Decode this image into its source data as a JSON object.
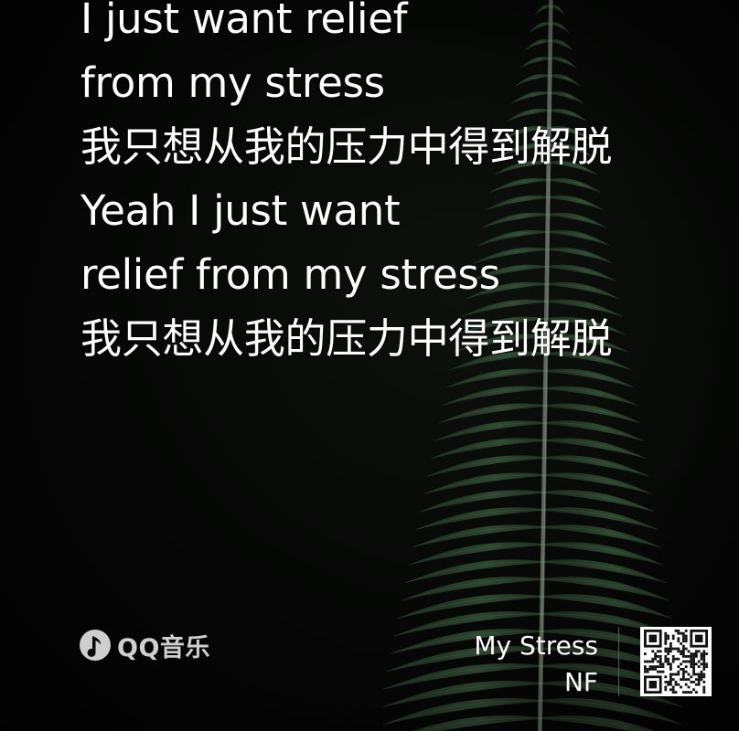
{
  "lyrics": [
    "I just want relief",
    "from my stress",
    "我只想从我的压力中得到解脱",
    "Yeah I just want",
    "relief from my stress",
    "我只想从我的压力中得到解脱"
  ],
  "brand": {
    "name": "QQ音乐",
    "icon": "qq-music-logo-icon"
  },
  "song": {
    "title": "My Stress",
    "artist": "NF"
  },
  "qr_code": {
    "icon": "qr-code-icon"
  },
  "colors": {
    "background": "#050505",
    "text": "#ffffff",
    "brand_text": "#cfcfcf",
    "fern": "#2f4a30",
    "divider": "#5c5c5c"
  }
}
